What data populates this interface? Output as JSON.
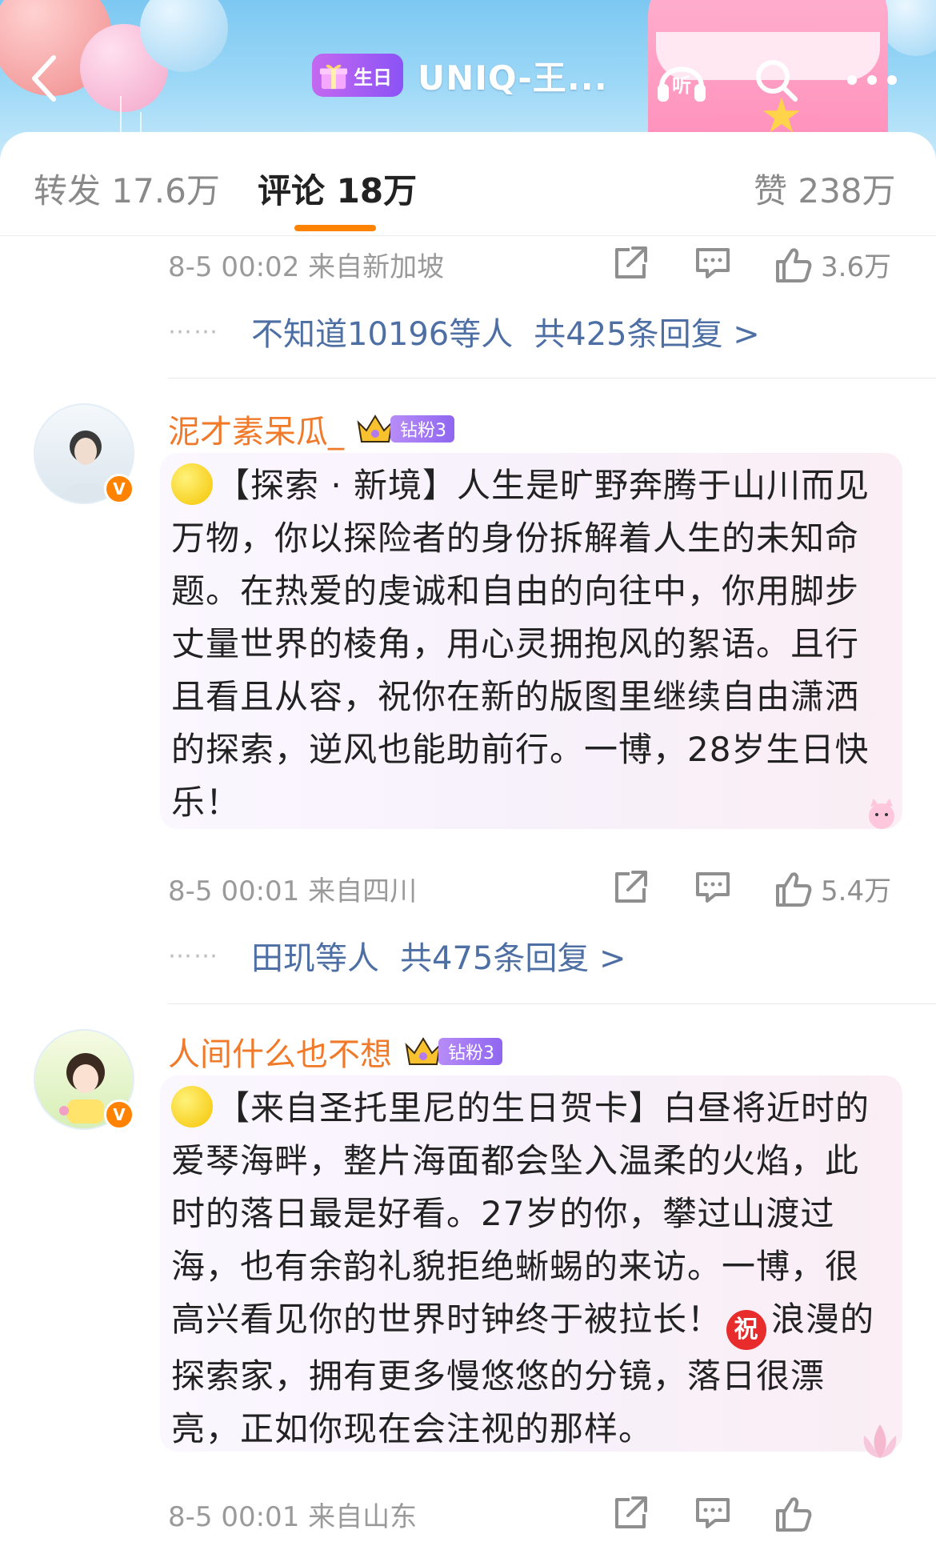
{
  "header": {
    "title": "UNIQ-王...",
    "birthday_badge": "生日",
    "listen_icon": "listen-icon",
    "search_icon": "search-icon",
    "more_icon": "more-icon"
  },
  "tabs": {
    "repost": "转发 17.6万",
    "comments": "评论 18万",
    "likes": "赞 238万"
  },
  "comments": [
    {
      "meta": "8-5 00:02 来自新加坡",
      "like_count": "3.6万",
      "replies_by": "不知道10196等人",
      "replies_total": "共425条回复 >"
    },
    {
      "username": "泥才素呆瓜_",
      "fan_level": "钻粉3",
      "text_prefix": "【探索 · 新境】人生是旷野奔腾于山川而见",
      "text_body": "万物，你以探险者的身份拆解着人生的未知命题。在热爱的虔诚和自由的向往中，你用脚步丈量世界的棱角，用心灵拥抱风的絮语。且行且看且从容，祝你在新的版图里继续自由潇洒的探索，逆风也能助前行。一博，28岁生日快乐！",
      "meta": "8-5 00:01 来自四川",
      "like_count": "5.4万",
      "replies_by": "田玑等人",
      "replies_total": "共475条回复 >"
    },
    {
      "username": "人间什么也不想",
      "fan_level": "钻粉3",
      "text_part1": "【来自圣托里尼的生日贺卡】白昼将近时的爱琴海畔，整片海面都会坠入温柔的火焰，此时的落日最是好看。27岁的你，攀过山渡过海，也有余韵礼貌拒绝蜥蜴的来访。一博，很高兴看见你的世界时钟终于被拉长！",
      "zhu": "祝",
      "text_part2": "浪漫的探索家，拥有更多慢悠悠的分镜，落日很漂亮，正如你现在会注视的那样。",
      "meta": "8-5 00:01 来自山东"
    }
  ],
  "colors": {
    "accent": "#ff8200",
    "link": "#4e6fa3",
    "username": "#f07a2a"
  }
}
